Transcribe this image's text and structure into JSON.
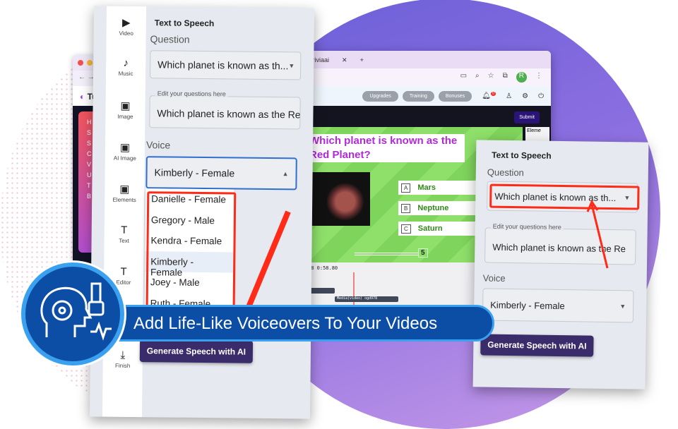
{
  "left_browser": {
    "logo": "Tube",
    "nav": "← →",
    "menu": [
      "H",
      "S",
      "S",
      "C",
      "V",
      "U",
      "T",
      "B"
    ]
  },
  "main_browser": {
    "tab_title": "triviaai",
    "header_buttons": [
      "Upgrades",
      "Training",
      "Bonuses"
    ],
    "notification_count": "0",
    "avatar_initial": "R",
    "submit_label": "Submit",
    "elements_label": "Eleme",
    "quiz": {
      "question": "Which planet is known as the Red Planet?",
      "options": [
        {
          "letter": "A",
          "text": "Mars"
        },
        {
          "letter": "B",
          "text": "Neptune"
        },
        {
          "letter": "C",
          "text": "Saturn"
        }
      ],
      "timer": "5"
    },
    "timeline": {
      "time": "38  0:58.80",
      "clip_label": "Media(video) ogd978"
    }
  },
  "left_panel": {
    "sidebar": [
      "Video",
      "Music",
      "Image",
      "AI Image",
      "Elements",
      "Text",
      "Editor",
      "Finish"
    ],
    "title": "Text to Speech",
    "question_label": "Question",
    "question_value": "Which planet is known as th...",
    "edit_label": "Edit your questions here",
    "edit_value": "Which planet is known as the Re",
    "voice_label": "Voice",
    "voice_value": "Kimberly - Female",
    "voice_options": [
      "Danielle - Female",
      "Gregory - Male",
      "Kendra - Female",
      "Kimberly - Female",
      "Joey - Male",
      "Ruth - Female"
    ],
    "generate_label": "Generate Speech with AI"
  },
  "right_panel": {
    "title": "Text to Speech",
    "question_label": "Question",
    "question_value": "Which planet is known as th...",
    "edit_label": "Edit your questions here",
    "edit_value": "Which planet is known as the Re",
    "voice_label": "Voice",
    "voice_value": "Kimberly - Female",
    "generate_label": "Generate Speech with AI"
  },
  "banner": {
    "text": "Add Life-Like Voiceovers To Your Videos",
    "icon": "headset-voice-icon"
  },
  "colors": {
    "accent_purple": "#8a6ee0",
    "highlight_red": "#ff2a17",
    "banner_blue": "#0c4ea6",
    "button": "#3a2c6a"
  }
}
